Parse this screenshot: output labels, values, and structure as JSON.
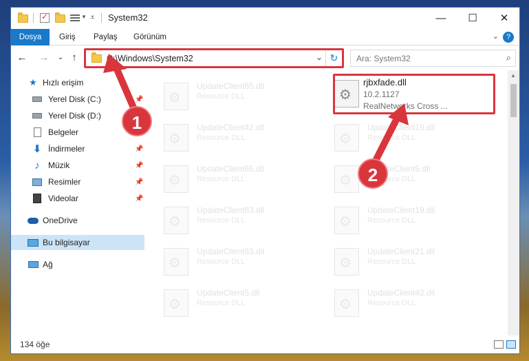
{
  "window": {
    "title": "System32",
    "controls": {
      "minimize": "—",
      "maximize": "☐",
      "close": "✕"
    }
  },
  "ribbon": {
    "tabs": [
      {
        "label": "Dosya"
      },
      {
        "label": "Giriş"
      },
      {
        "label": "Paylaş"
      },
      {
        "label": "Görünüm"
      }
    ],
    "help": "?"
  },
  "address": {
    "path": "C:\\Windows\\System32",
    "search_placeholder": "Ara: System32"
  },
  "nav": {
    "items": [
      {
        "label": "Hızlı erişim",
        "icon": "star-icon",
        "pinned": false
      },
      {
        "label": "Yerel Disk (C:)",
        "icon": "drive-icon",
        "pinned": true
      },
      {
        "label": "Yerel Disk (D:)",
        "icon": "drive-icon",
        "pinned": false
      },
      {
        "label": "Belgeler",
        "icon": "documents-icon",
        "pinned": false
      },
      {
        "label": "İndirmeler",
        "icon": "download-icon",
        "pinned": true
      },
      {
        "label": "Müzik",
        "icon": "music-icon",
        "pinned": true
      },
      {
        "label": "Resimler",
        "icon": "pictures-icon",
        "pinned": true
      },
      {
        "label": "Videolar",
        "icon": "video-icon",
        "pinned": true
      },
      {
        "label": "OneDrive",
        "icon": "cloud-icon",
        "pinned": false
      },
      {
        "label": "Bu bilgisayar",
        "icon": "computer-icon",
        "pinned": false,
        "selected": true
      },
      {
        "label": "Ağ",
        "icon": "network-icon",
        "pinned": false
      }
    ]
  },
  "files": {
    "focused": {
      "name": "rjbxfade.dll",
      "version": "10.2.1127",
      "company": "RealNetworks Cross ..."
    },
    "left_column": [
      {
        "name": "UpdateClient65.dll",
        "desc": "Resource DLL"
      },
      {
        "name": "UpdateClient42.dll",
        "desc": "Resource DLL"
      },
      {
        "name": "UpdateClient65.dll",
        "desc": "Resource DLL"
      },
      {
        "name": "UpdateClient63.dll",
        "desc": "Resource DLL"
      },
      {
        "name": "UpdateClient63.dll",
        "desc": "Resource DLL"
      },
      {
        "name": "UpdateClient5.dll",
        "desc": "Resource DLL"
      }
    ],
    "right_column": [
      {
        "name": "UpdateClient19.dll",
        "desc": "Resource DLL"
      },
      {
        "name": "UpdateClient5.dll",
        "desc": "Resource DLL"
      },
      {
        "name": "UpdateClient19.dll",
        "desc": "Resource DLL"
      },
      {
        "name": "UpdateClient21.dll",
        "desc": "Resource DLL"
      },
      {
        "name": "UpdateClient42.dll",
        "desc": "Resource DLL"
      }
    ]
  },
  "status": {
    "count": "134 öğe"
  },
  "annotations": {
    "badge1": "1",
    "badge2": "2"
  },
  "colors": {
    "accent": "#1979ca",
    "highlight": "#d9353d",
    "selected": "#cce4f7"
  }
}
